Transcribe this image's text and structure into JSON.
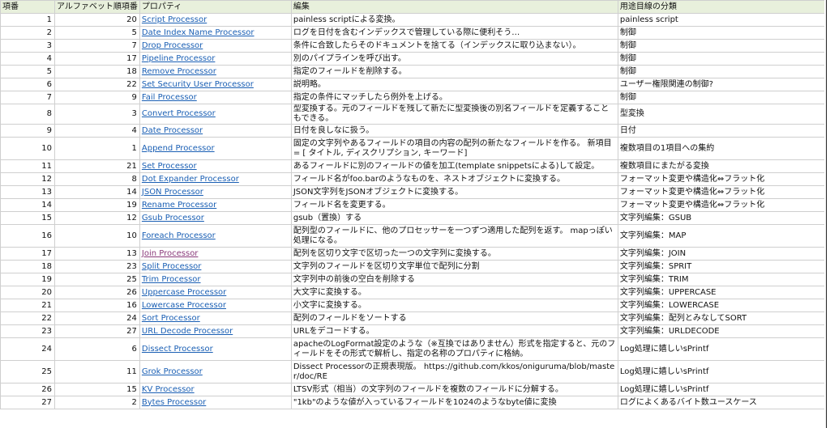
{
  "headers": [
    "項番",
    "アルファベット順項番",
    "プロパティ",
    "編集",
    "用途目線の分類"
  ],
  "rows": [
    {
      "no": "1",
      "alpha": "20",
      "name": "Script Processor",
      "edit": "painless scriptによる変換。",
      "cat": "painless script",
      "tall": false
    },
    {
      "no": "2",
      "alpha": "5",
      "name": "Date Index Name Processor",
      "edit": "ログを日付を含むインデックスで管理している際に便利そう…",
      "cat": "制御",
      "tall": false
    },
    {
      "no": "3",
      "alpha": "7",
      "name": "Drop Processor",
      "edit": "条件に合致したらそのドキュメントを捨てる（インデックスに取り込まない）。",
      "cat": "制御",
      "tall": false
    },
    {
      "no": "4",
      "alpha": "17",
      "name": "Pipeline Processor",
      "edit": "別のパイプラインを呼び出す。",
      "cat": "制御",
      "tall": false
    },
    {
      "no": "5",
      "alpha": "18",
      "name": "Remove Processor",
      "edit": "指定のフィールドを削除する。",
      "cat": "制御",
      "tall": false
    },
    {
      "no": "6",
      "alpha": "22",
      "name": "Set Security User Processor",
      "edit": "説明略。",
      "cat": "ユーザー権限関連の制御?",
      "tall": false
    },
    {
      "no": "7",
      "alpha": "9",
      "name": "Fail Processor",
      "edit": "指定の条件にマッチしたら例外を上げる。",
      "cat": "制御",
      "tall": false
    },
    {
      "no": "8",
      "alpha": "3",
      "name": "Convert Processor",
      "edit": "型変換する。元のフィールドを残して新たに型変換後の別名フィールドを定義することもできる。",
      "cat": "型変換",
      "tall": false
    },
    {
      "no": "9",
      "alpha": "4",
      "name": "Date Processor",
      "edit": "日付を良しなに扱う。",
      "cat": "日付",
      "tall": false
    },
    {
      "no": "10",
      "alpha": "1",
      "name": "Append Processor",
      "edit": "固定の文字列やあるフィールドの項目の内容の配列の新たなフィールドを作る。 新項目 = [ タイトル, ディスクリプション, キーワード]",
      "cat": "複数項目の1項目への集約",
      "tall": true
    },
    {
      "no": "11",
      "alpha": "21",
      "name": "Set Processor",
      "edit": "あるフィールドに別のフィールドの値を加工(template snippetsによる)して設定。",
      "cat": "複数項目にまたがる変換",
      "tall": false
    },
    {
      "no": "12",
      "alpha": "8",
      "name": "Dot Expander Processor",
      "edit": "フィールド名がfoo.barのようなものを、ネストオブジェクトに変換する。",
      "cat": "フォーマット変更や構造化⇔フラット化",
      "tall": false
    },
    {
      "no": "13",
      "alpha": "14",
      "name": "JSON Processor",
      "edit": "JSON文字列をJSONオブジェクトに変換する。",
      "cat": "フォーマット変更や構造化⇔フラット化",
      "tall": false
    },
    {
      "no": "14",
      "alpha": "19",
      "name": "Rename Processor",
      "edit": "フィールド名を変更する。",
      "cat": "フォーマット変更や構造化⇔フラット化",
      "tall": false
    },
    {
      "no": "15",
      "alpha": "12",
      "name": "Gsub Processor",
      "edit": "gsub（置換）する",
      "cat": "文字列編集：GSUB",
      "tall": false
    },
    {
      "no": "16",
      "alpha": "10",
      "name": "Foreach Processor",
      "edit": "配列型のフィールドに、他のプロセッサーを一つずつ適用した配列を返す。 mapっぽい処理になる。",
      "cat": "文字列編集：MAP",
      "tall": true
    },
    {
      "no": "17",
      "alpha": "13",
      "name": "Join Processor",
      "edit": "配列を区切り文字で区切った一つの文字列に変換する。",
      "cat": "文字列編集：JOIN",
      "tall": false,
      "visited": true
    },
    {
      "no": "18",
      "alpha": "23",
      "name": "Split Processor",
      "edit": "文字列のフィールドを区切り文字単位で配列に分割",
      "cat": "文字列編集：SPRIT",
      "tall": false
    },
    {
      "no": "19",
      "alpha": "25",
      "name": "Trim Processor",
      "edit": "文字列中の前後の空白を削除する",
      "cat": "文字列編集：TRIM",
      "tall": false
    },
    {
      "no": "20",
      "alpha": "26",
      "name": "Uppercase Processor",
      "edit": "大文字に変換する。",
      "cat": "文字列編集：UPPERCASE",
      "tall": false
    },
    {
      "no": "21",
      "alpha": "16",
      "name": "Lowercase Processor",
      "edit": "小文字に変換する。",
      "cat": "文字列編集：LOWERCASE",
      "tall": false
    },
    {
      "no": "22",
      "alpha": "24",
      "name": "Sort Processor",
      "edit": "配列のフィールドをソートする",
      "cat": "文字列編集：配列とみなしてSORT",
      "tall": false
    },
    {
      "no": "23",
      "alpha": "27",
      "name": "URL Decode Processor",
      "edit": "URLをデコードする。",
      "cat": "文字列編集：URLDECODE",
      "tall": false
    },
    {
      "no": "24",
      "alpha": "6",
      "name": "Dissect Processor",
      "edit": "apacheのLogFormat設定のような（※互換ではありません）形式を指定すると、元のフィールドをその形式で解析し、指定の名称のプロパティに格納。",
      "cat": "Log処理に嬉しいsPrintf",
      "tall": true
    },
    {
      "no": "25",
      "alpha": "11",
      "name": "Grok Processor",
      "edit": "Dissect Processorの正規表現版。 https://github.com/kkos/oniguruma/blob/master/doc/RE",
      "cat": "Log処理に嬉しいsPrintf",
      "tall": true
    },
    {
      "no": "26",
      "alpha": "15",
      "name": "KV Processor",
      "edit": "LTSV形式（相当）の文字列のフィールドを複数のフィールドに分解する。",
      "cat": "Log処理に嬉しいsPrintf",
      "tall": false
    },
    {
      "no": "27",
      "alpha": "2",
      "name": "Bytes Processor",
      "edit": "\"1kb\"のような値が入っているフィールドを1024のようなbyte値に変換",
      "cat": "ログによくあるバイト数ユースケース",
      "tall": false
    }
  ]
}
